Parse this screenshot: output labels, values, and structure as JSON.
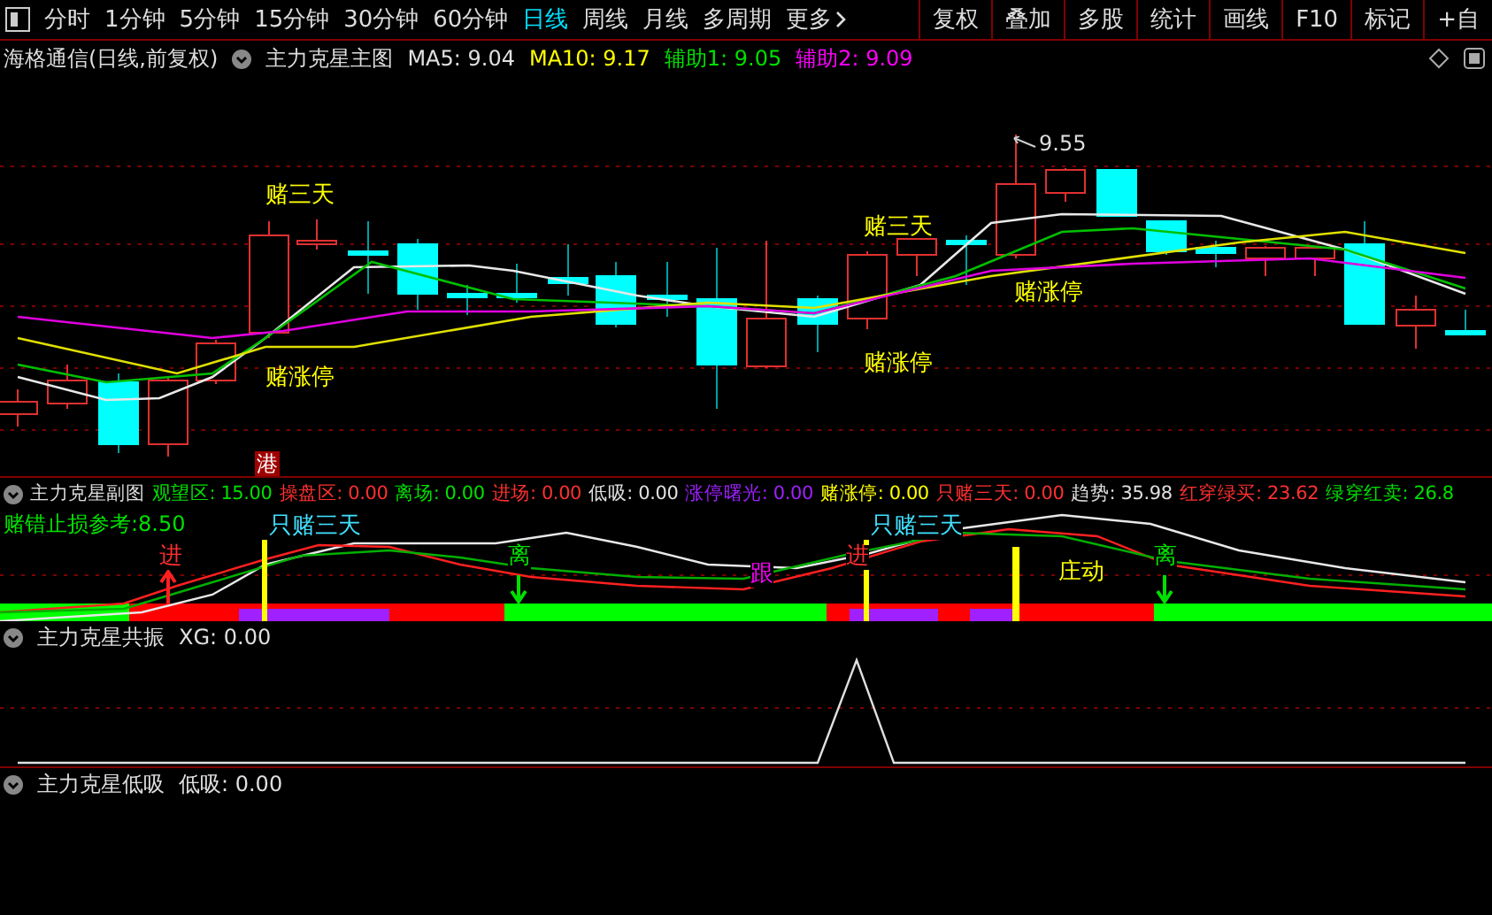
{
  "toolbar": {
    "periods": [
      {
        "label": "分时",
        "selected": false
      },
      {
        "label": "1分钟",
        "selected": false
      },
      {
        "label": "5分钟",
        "selected": false
      },
      {
        "label": "15分钟",
        "selected": false
      },
      {
        "label": "30分钟",
        "selected": false
      },
      {
        "label": "60分钟",
        "selected": false
      },
      {
        "label": "日线",
        "selected": true
      },
      {
        "label": "周线",
        "selected": false
      },
      {
        "label": "月线",
        "selected": false
      },
      {
        "label": "多周期",
        "selected": false
      }
    ],
    "more": "更多",
    "tools": [
      "复权",
      "叠加",
      "多股",
      "统计",
      "画线",
      "F10",
      "标记",
      "+自"
    ]
  },
  "main_chart": {
    "security": "海格通信(日线,前复权)",
    "indicator": "主力克星主图",
    "readings": [
      {
        "text": "MA5: 9.04",
        "color": "#e0e0e0"
      },
      {
        "text": "MA10: 9.17",
        "color": "#ffff00"
      },
      {
        "text": "辅助1: 9.05",
        "color": "#00e000"
      },
      {
        "text": "辅助2: 9.09",
        "color": "#ff00ff"
      }
    ],
    "labels": [
      {
        "text": "赌三天",
        "color": "#ffff00"
      },
      {
        "text": "赌涨停",
        "color": "#ffff00"
      },
      {
        "text": "赌三天",
        "color": "#ffff00"
      },
      {
        "text": "赌涨停",
        "color": "#ffff00"
      },
      {
        "text": "赌涨停",
        "color": "#ffff00"
      }
    ],
    "high_mark": "9.55",
    "badge": "港"
  },
  "sub_chart": {
    "indicator": "主力克星副图",
    "readings": [
      {
        "text": "观望区: 15.00",
        "color": "#00e000"
      },
      {
        "text": "操盘区: 0.00",
        "color": "#ff3030"
      },
      {
        "text": "离场: 0.00",
        "color": "#00e000"
      },
      {
        "text": "进场: 0.00",
        "color": "#ff3030"
      },
      {
        "text": "低吸: 0.00",
        "color": "#e0e0e0"
      },
      {
        "text": "涨停曙光: 0.00",
        "color": "#a020ff"
      },
      {
        "text": "赌涨停: 0.00",
        "color": "#ffff00"
      },
      {
        "text": "只赌三天: 0.00",
        "color": "#ff3030"
      },
      {
        "text": "趋势: 35.98",
        "color": "#e0e0e0"
      },
      {
        "text": "红穿绿买: 23.62",
        "color": "#ff3030"
      },
      {
        "text": "绿穿红卖: 26.8",
        "color": "#00e000"
      }
    ],
    "note": "赌错止损参考:8.50",
    "labels": [
      {
        "text": "只赌三天",
        "color": "#40e0ff"
      },
      {
        "text": "进",
        "color": "#ff3030"
      },
      {
        "text": "离",
        "color": "#00e000"
      },
      {
        "text": "跟",
        "color": "#ff00ff"
      },
      {
        "text": "只赌三天",
        "color": "#40e0ff"
      },
      {
        "text": "进",
        "color": "#ff3030"
      },
      {
        "text": "庄动",
        "color": "#ffff00"
      },
      {
        "text": "离",
        "color": "#00e000"
      }
    ]
  },
  "resonance_panel": {
    "indicator": "主力克星共振",
    "readings": [
      {
        "text": "XG: 0.00",
        "color": "#e0e0e0"
      }
    ]
  },
  "low_buy_panel": {
    "indicator": "主力克星低吸",
    "readings": [
      {
        "text": "低吸: 0.00",
        "color": "#e0e0e0"
      }
    ]
  }
}
